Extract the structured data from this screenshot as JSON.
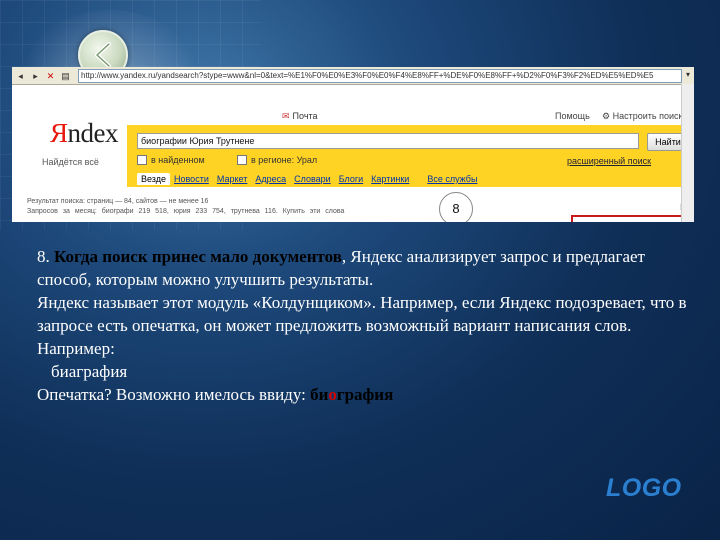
{
  "browser": {
    "url": "http://www.yandex.ru/yandsearch?stype=www&nl=0&text=%E1%F0%E0%E3%F0%E0%F4%E8%FF+%DE%F0%E8%FF+%D2%F0%F3%F2%ED%E5%ED%E5"
  },
  "yandex": {
    "logo_first": "Я",
    "logo_rest": "ndex",
    "found_label": "Найдётся всё",
    "mail_link": "Почта",
    "help_link": "Помощь",
    "settings_link": "Настроить поиск",
    "query": "биографии Юрия Трутнене",
    "find_button": "Найти",
    "opt_found": "в найденном",
    "opt_region": "в регионе: Урал",
    "advanced_link": "расширенный поиск",
    "tabs": [
      {
        "label": "Везде"
      },
      {
        "label": "Новости"
      },
      {
        "label": "Маркет"
      },
      {
        "label": "Адреса"
      },
      {
        "label": "Словари"
      },
      {
        "label": "Блоги"
      },
      {
        "label": "Картинки"
      },
      {
        "label": "Все службы"
      }
    ],
    "stats_line1": "Результат поиска: страниц — 84, сайтов — не менее 16",
    "stats_line2": "Запросов за месяц: биографи 219 518, юрия 233 754, трутнева 116. Купить эти слова"
  },
  "step_badge": "8",
  "body": {
    "p1_num": "8. ",
    "p1_bold": "Когда поиск принес мало документов",
    "p1_rest": ", Яндекс анализирует запрос и предлагает способ, которым можно улучшить результаты.",
    "p2": "Яндекс называет этот модуль «Колдунщиком». Например, если Яндекс подозревает, что в запросе есть опечатка, он может предложить возможный вариант написания слов.",
    "p3": "Например:",
    "p4": "биаграфия",
    "p5_prefix": "Опечатка? Возможно имелось ввиду: ",
    "p5_b1": "би",
    "p5_red": "о",
    "p5_b2": "графия"
  },
  "footer_logo": "LOGO",
  "colors": {
    "yandex_yellow": "#ffd324",
    "highlight_red": "#d40000",
    "logo_blue": "#2a7fd0"
  }
}
